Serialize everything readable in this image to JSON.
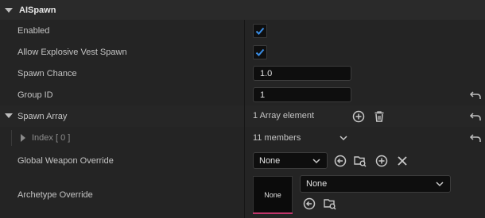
{
  "category": {
    "title": "AISpawn"
  },
  "rows": {
    "enabled": {
      "label": "Enabled",
      "checked": true
    },
    "allow_vest": {
      "label": "Allow Explosive Vest Spawn",
      "checked": true
    },
    "spawn_chance": {
      "label": "Spawn Chance",
      "value": "1.0"
    },
    "group_id": {
      "label": "Group ID",
      "value": "1"
    },
    "spawn_array": {
      "label": "Spawn Array",
      "summary": "1 Array element"
    },
    "index0": {
      "label": "Index [ 0 ]",
      "summary": "11 members"
    },
    "global_weapon": {
      "label": "Global Weapon Override",
      "selected": "None"
    },
    "archetype": {
      "label": "Archetype Override",
      "thumbnail_label": "None",
      "selected": "None"
    }
  },
  "colors": {
    "checkbox_check": "#3a8ee6",
    "thumbnail_accent": "#c1356b"
  },
  "icons": [
    "dropdown-arrow-icon",
    "checkmark-icon",
    "reset-to-default-icon",
    "add-element-icon",
    "delete-all-icon",
    "expand-arrow-icon",
    "use-selected-icon",
    "browse-to-asset-icon",
    "clear-icon",
    "chevron-down-icon"
  ]
}
